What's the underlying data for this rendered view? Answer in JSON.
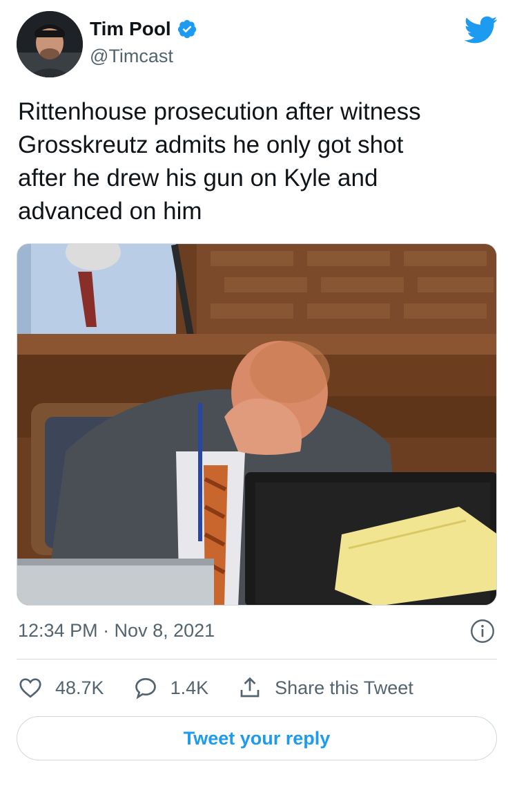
{
  "author": {
    "name": "Tim Pool",
    "handle": "@Timcast"
  },
  "tweet": {
    "text_lines": [
      "Rittenhouse prosecution after witness",
      "Grosskreutz admits he only got shot",
      "after he drew his gun on Kyle and",
      "advanced on him"
    ],
    "timestamp": "12:34 PM · Nov 8, 2021"
  },
  "actions": {
    "likes": "48.7K",
    "replies": "1.4K",
    "share_label": "Share this Tweet"
  },
  "reply_button": "Tweet your reply",
  "colors": {
    "accent": "#1d9bf0",
    "secondary_text": "#536471",
    "border": "#cfd9de"
  },
  "icons": [
    "verified-badge-icon",
    "twitter-bird-icon",
    "info-icon",
    "heart-icon",
    "reply-bubble-icon",
    "share-icon"
  ]
}
